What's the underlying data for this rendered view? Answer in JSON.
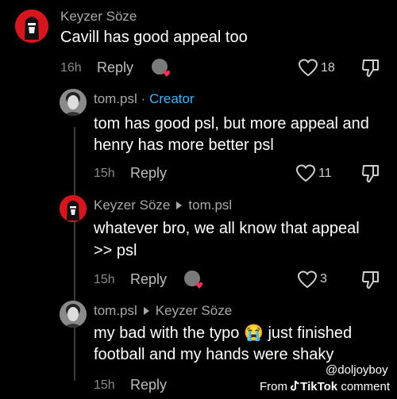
{
  "comments": [
    {
      "author": "Keyzer Söze",
      "text_lines": [
        "Cavill has good appeal too"
      ],
      "time": "16h",
      "reply_label": "Reply",
      "likes": "18"
    },
    {
      "author": "tom.psl",
      "separator": "·",
      "badge": "Creator",
      "text_lines": [
        "tom has good psl, but more appeal and",
        "henry has more better psl"
      ],
      "time": "15h",
      "reply_label": "Reply",
      "likes": "11"
    },
    {
      "author": "Keyzer Söze",
      "reply_to": "tom.psl",
      "text_lines": [
        "whatever bro, we all know that appeal",
        ">> psl"
      ],
      "time": "15h",
      "reply_label": "Reply",
      "likes": "3"
    },
    {
      "author": "tom.psl",
      "reply_to": "Keyzer Söze",
      "text_lines": [
        "my bad with the typo",
        "just finished",
        "football and my hands were shaky"
      ],
      "emoji": "😭",
      "time": "15h",
      "reply_label": "Reply"
    }
  ],
  "watermark": {
    "handle": "@doljoyboy",
    "from": "From",
    "brand": "TikTok",
    "suffix": "comment"
  },
  "icons": [
    "heart-icon",
    "dislike-icon",
    "creator-liked-icon",
    "tiktok-logo-icon"
  ],
  "colors": {
    "background": "#000000",
    "creator_badge": "#39b4ff",
    "avatar_red": "#d8141c"
  }
}
